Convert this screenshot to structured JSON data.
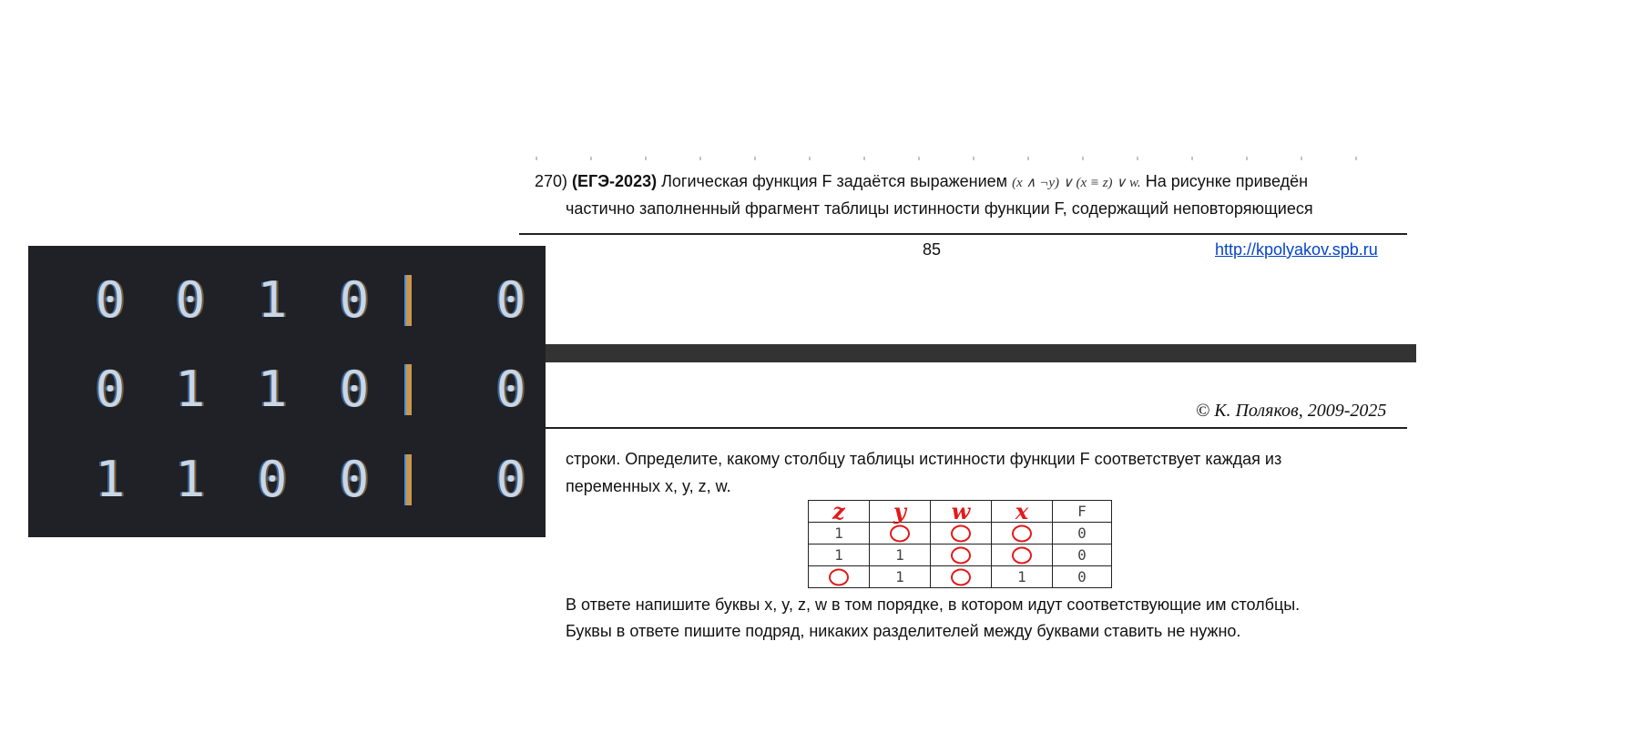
{
  "task": {
    "number": "270)",
    "source": "(ЕГЭ-2023)",
    "line1_text": "Логическая функция F задаётся выражением",
    "expression": "(x ∧ ¬y) ∨ (x ≡ z) ∨ w.",
    "line1_tail": "На рисунке приведён",
    "line2": "частично заполненный фрагмент таблицы истинности функции F, содержащий неповторяющиеся",
    "line3": "строки. Определите, какому столбцу таблицы истинности функции F соответствует каждая из",
    "line4": "переменных x, y, z, w.",
    "answer_line1": "В ответе напишите буквы x, y, z, w в том порядке, в котором идут соответствующие им столбцы.",
    "answer_line2": "Буквы в ответе пишите подряд, никаких разделителей между буквами ставить не нужно."
  },
  "footer": {
    "page_number": "85",
    "link": "http://kpolyakov.spb.ru"
  },
  "header": {
    "copyright": "© К. Поляков, 2009-2025"
  },
  "terminal": {
    "rows": [
      {
        "values": [
          "0",
          "0",
          "1",
          "0"
        ],
        "sep": "|",
        "result": "0"
      },
      {
        "values": [
          "0",
          "1",
          "1",
          "0"
        ],
        "sep": "|",
        "result": "0"
      },
      {
        "values": [
          "1",
          "1",
          "0",
          "0"
        ],
        "sep": "|",
        "result": "0"
      }
    ]
  },
  "truth_table": {
    "header": [
      "z",
      "y",
      "w",
      "x",
      "F"
    ],
    "header_handwritten": [
      true,
      true,
      true,
      true,
      false
    ],
    "rows": [
      {
        "cells": [
          "1",
          "0",
          "0",
          "0",
          "0"
        ],
        "handwritten": [
          false,
          true,
          true,
          true,
          false
        ]
      },
      {
        "cells": [
          "1",
          "1",
          "0",
          "0",
          "0"
        ],
        "handwritten": [
          false,
          false,
          true,
          true,
          false
        ]
      },
      {
        "cells": [
          "0",
          "1",
          "0",
          "1",
          "0"
        ],
        "handwritten": [
          true,
          false,
          true,
          false,
          false
        ]
      }
    ]
  },
  "colors": {
    "terminal_bg": "#1f2126",
    "handwriting": "#e31a1a",
    "link": "#0645c9",
    "separator_bar": "#333333"
  }
}
